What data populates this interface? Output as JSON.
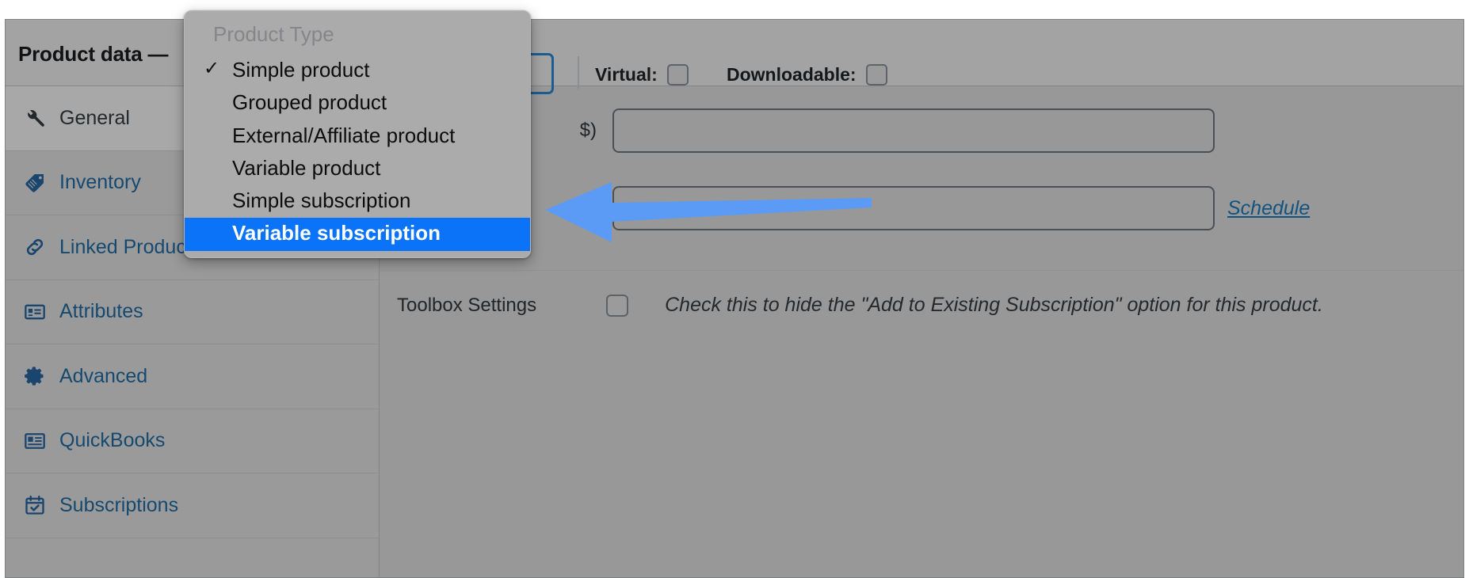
{
  "header": {
    "title": "Product data —",
    "product_type_selected": "Simple product",
    "virtual": {
      "label": "Virtual:",
      "checked": false
    },
    "downloadable": {
      "label": "Downloadable:",
      "checked": false
    }
  },
  "dropdown": {
    "heading": "Product Type",
    "check_glyph": "✓",
    "highlight_color": "#0a73f7",
    "items": [
      {
        "label": "Simple product",
        "checked": true,
        "selected": false
      },
      {
        "label": "Grouped product",
        "checked": false,
        "selected": false
      },
      {
        "label": "External/Affiliate product",
        "checked": false,
        "selected": false
      },
      {
        "label": "Variable product",
        "checked": false,
        "selected": false
      },
      {
        "label": "Simple subscription",
        "checked": false,
        "selected": false
      },
      {
        "label": "Variable subscription",
        "checked": false,
        "selected": true
      }
    ]
  },
  "sidebar": {
    "items": [
      {
        "label": "General",
        "icon": "wrench-icon",
        "active": true
      },
      {
        "label": "Inventory",
        "icon": "tag-icon",
        "active": false
      },
      {
        "label": "Linked Products",
        "icon": "link-icon",
        "active": false
      },
      {
        "label": "Attributes",
        "icon": "list-card-icon",
        "active": false
      },
      {
        "label": "Advanced",
        "icon": "gear-icon",
        "active": false
      },
      {
        "label": "QuickBooks",
        "icon": "id-card-icon",
        "active": false
      },
      {
        "label": "Subscriptions",
        "icon": "calendar-check-icon",
        "active": false
      }
    ]
  },
  "content": {
    "fields": [
      {
        "label": "$)",
        "value": ""
      },
      {
        "label": "",
        "value": "",
        "link": "Schedule"
      }
    ],
    "schedule_link": "Schedule",
    "toolbox": {
      "label": "Toolbox Settings",
      "checked": false,
      "description": "Check this to hide the \"Add to Existing Subscription\" option for this product."
    }
  },
  "annotation": {
    "arrow_color": "#5b9bf5",
    "points_to": "Variable subscription"
  }
}
